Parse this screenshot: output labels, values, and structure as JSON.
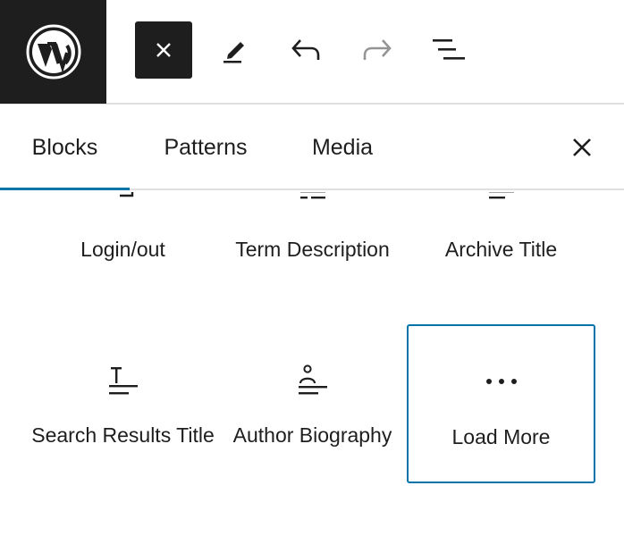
{
  "toolbar": {
    "logo": "wordpress-logo",
    "close_icon": "close-icon",
    "edit_icon": "pencil-icon",
    "undo_icon": "undo-icon",
    "redo_icon": "redo-icon",
    "list_icon": "list-view-icon"
  },
  "tabs": [
    {
      "label": "Blocks",
      "active": true
    },
    {
      "label": "Patterns",
      "active": false
    },
    {
      "label": "Media",
      "active": false
    }
  ],
  "blocks": [
    {
      "label": "Login/out",
      "icon": "login-icon"
    },
    {
      "label": "Term Description",
      "icon": "term-description-icon"
    },
    {
      "label": "Archive Title",
      "icon": "archive-title-icon"
    },
    {
      "label": "Search Results Title",
      "icon": "search-title-icon"
    },
    {
      "label": "Author Biography",
      "icon": "author-bio-icon"
    },
    {
      "label": "Load More",
      "icon": "more-dots-icon",
      "selected": true
    }
  ],
  "colors": {
    "dark": "#1e1e1e",
    "accent": "#0073aa",
    "border": "#e0e0e0",
    "disabled": "#949494"
  }
}
